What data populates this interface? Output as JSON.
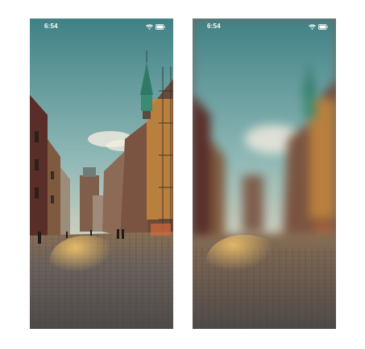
{
  "screens": [
    {
      "id": "left",
      "status_bar": {
        "time": "6:54"
      },
      "icons": [
        "wifi-icon",
        "battery-icon"
      ],
      "scene": "city-street-sharp"
    },
    {
      "id": "right",
      "status_bar": {
        "time": "6:54"
      },
      "icons": [
        "wifi-icon",
        "battery-icon"
      ],
      "scene": "city-street-blurred-background"
    }
  ],
  "colors": {
    "sky_top": "#4f8d90",
    "sky_bottom": "#d9d6c4",
    "cobblestone": "#6c6763",
    "glow": "#e6b55a"
  }
}
